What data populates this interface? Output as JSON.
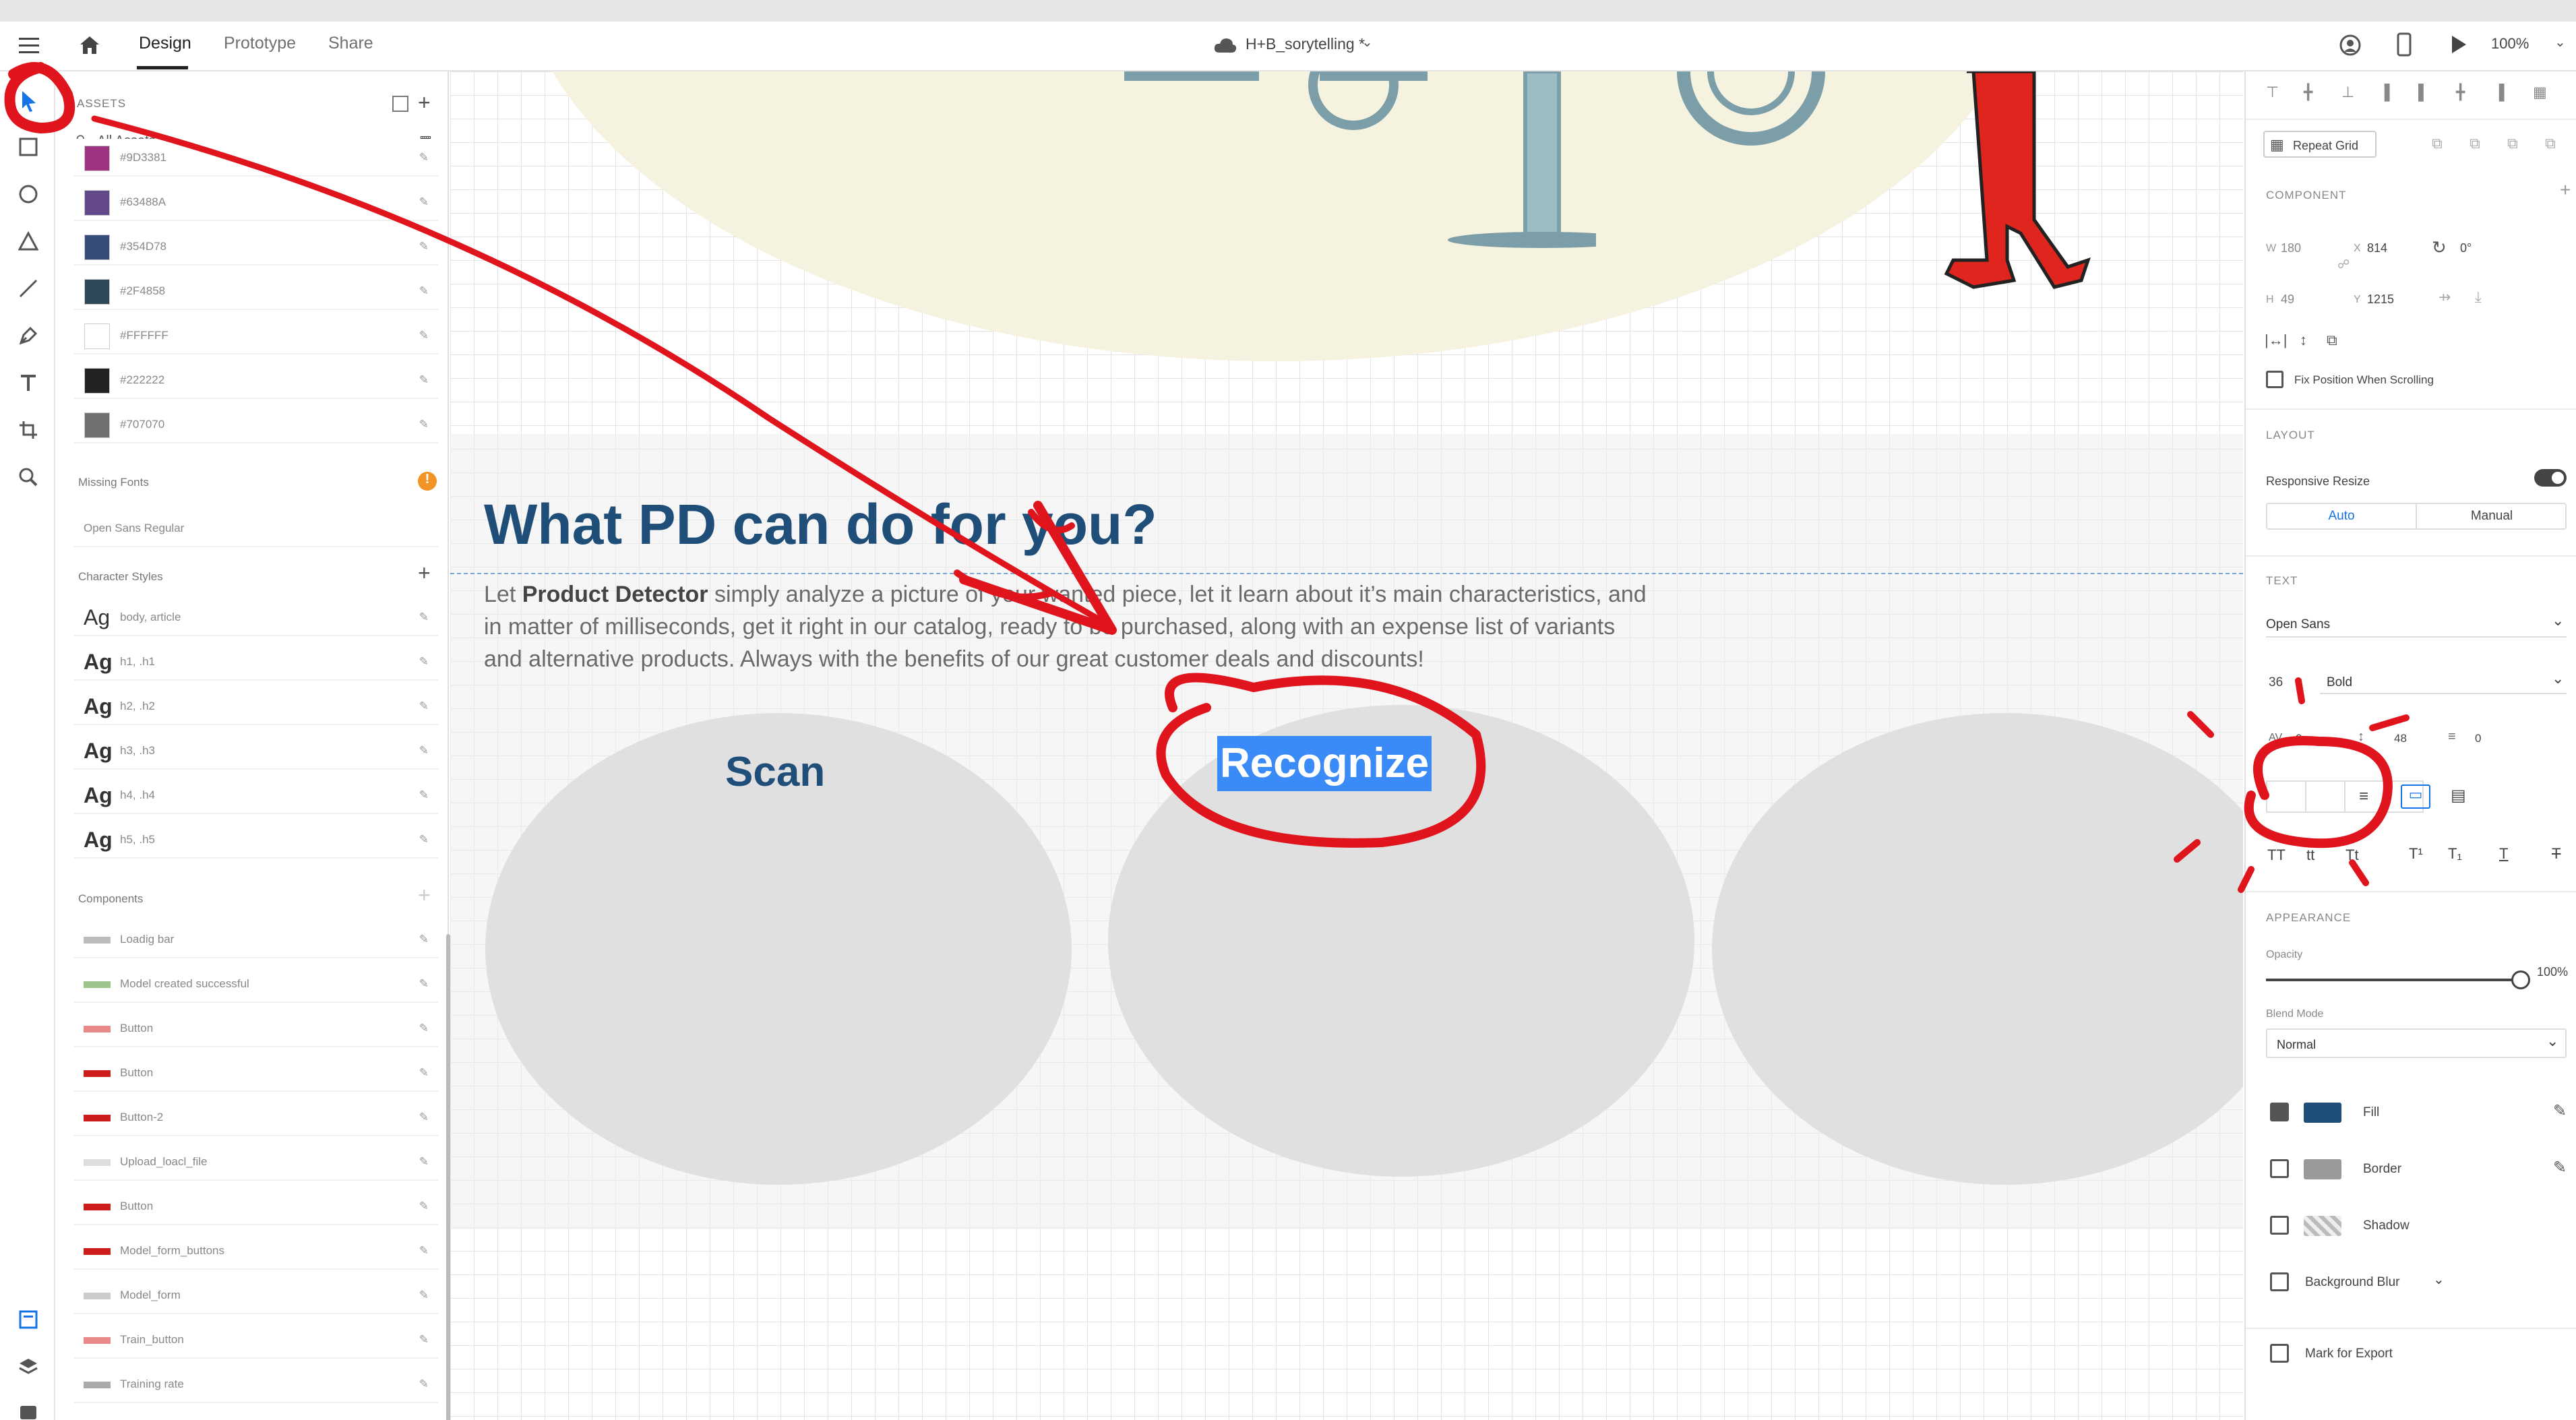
{
  "header": {
    "tabs": [
      {
        "label": "Design",
        "active": true
      },
      {
        "label": "Prototype",
        "active": false
      },
      {
        "label": "Share",
        "active": false
      }
    ],
    "document_title": "H+B_sorytelling *",
    "zoom": "100%"
  },
  "assets": {
    "title": "ASSETS",
    "filter": "All Assets",
    "colors": [
      {
        "label": "#9D3381",
        "hex": "#9D3381"
      },
      {
        "label": "#63488A",
        "hex": "#63488A"
      },
      {
        "label": "#354D78",
        "hex": "#354D78"
      },
      {
        "label": "#2F4858",
        "hex": "#2F4858"
      },
      {
        "label": "#FFFFFF",
        "hex": "#FFFFFF"
      },
      {
        "label": "#222222",
        "hex": "#222222"
      },
      {
        "label": "#707070",
        "hex": "#707070"
      }
    ],
    "missing_fonts_title": "Missing Fonts",
    "missing_fonts": [
      "Open Sans Regular"
    ],
    "character_styles_title": "Character Styles",
    "character_styles": [
      {
        "glyph": "Ag",
        "label": "body, article"
      },
      {
        "glyph": "Ag",
        "label": "h1, .h1"
      },
      {
        "glyph": "Ag",
        "label": "h2, .h2"
      },
      {
        "glyph": "Ag",
        "label": "h3, .h3"
      },
      {
        "glyph": "Ag",
        "label": "h4, .h4"
      },
      {
        "glyph": "Ag",
        "label": "h5, .h5"
      }
    ],
    "components_title": "Components",
    "components": [
      "Loadig bar",
      "Model created successful",
      "Button",
      "Button",
      "Button-2",
      "Upload_loacl_file",
      "Button",
      "Model_form_buttons",
      "Model_form",
      "Train_button",
      "Training rate"
    ]
  },
  "canvas": {
    "heading": "What PD can do for you?",
    "paragraph_pre": "Let ",
    "paragraph_bold": "Product Detector",
    "paragraph_line1": " simply analyze a picture of your wanted piece, let it learn about it’s  main characteristics, and",
    "paragraph_line2": "in matter of milliseconds, get it right in our catalog, ready to be purchased, along with an expense list of variants",
    "paragraph_line3": "and alternative products. Always with the benefits of our great customer deals and discounts!",
    "cards": [
      "Scan",
      "Recognize"
    ],
    "heading_color": "#1F4E79",
    "selection_color": "#3A8BF7"
  },
  "properties": {
    "repeat_grid": "Repeat Grid",
    "component_title": "COMPONENT",
    "w_label": "W",
    "w": "180",
    "x_label": "X",
    "x": "814",
    "h_label": "H",
    "h": "49",
    "y_label": "Y",
    "y": "1215",
    "rotation": "0°",
    "fix_position": "Fix Position When Scrolling",
    "layout_title": "LAYOUT",
    "responsive_resize": "Responsive Resize",
    "auto": "Auto",
    "manual": "Manual",
    "text_title": "TEXT",
    "font_family": "Open Sans",
    "font_size": "36",
    "font_weight": "Bold",
    "char_spacing_label": "AV",
    "char_spacing": "0",
    "line_spacing": "48",
    "para_spacing": "0",
    "appearance_title": "APPEARANCE",
    "opacity_label": "Opacity",
    "opacity_value": "100%",
    "opacity": 1.0,
    "blend_mode_label": "Blend Mode",
    "blend_mode": "Normal",
    "fill_label": "Fill",
    "fill_color": "#1F4E79",
    "border_label": "Border",
    "border_color": "#9A9A9A",
    "shadow_label": "Shadow",
    "bg_blur_label": "Background Blur",
    "mark_export": "Mark for Export",
    "transform_glyphs": [
      "TT",
      "tt",
      "Tt"
    ]
  },
  "annotation_color": "#E0141C"
}
